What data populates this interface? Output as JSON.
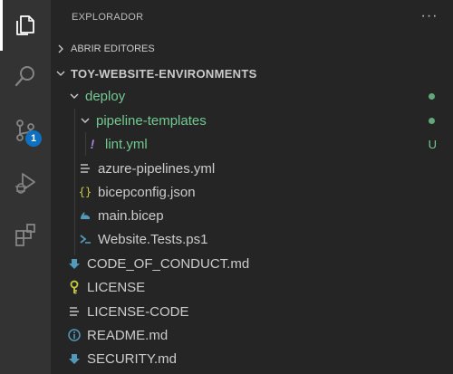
{
  "activity_bar": {
    "items": [
      {
        "name": "explorer-icon",
        "active": true
      },
      {
        "name": "search-icon",
        "active": false
      },
      {
        "name": "source-control-icon",
        "active": false,
        "badge": "1"
      },
      {
        "name": "run-debug-icon",
        "active": false
      },
      {
        "name": "extensions-icon",
        "active": false
      }
    ],
    "badge_color": "#0e70c0"
  },
  "sidebar": {
    "title": "EXPLORADOR",
    "more_label": "···",
    "open_editors_label": "ABRIR EDITORES",
    "workspace_label": "TOY-WEBSITE-ENVIRONMENTS",
    "tree": [
      {
        "label": "deploy",
        "type": "folder",
        "color": "#73c991",
        "decoration": "dot"
      },
      {
        "label": "pipeline-templates",
        "type": "folder",
        "color": "#73c991",
        "decoration": "dot"
      },
      {
        "label": "lint.yml",
        "type": "file",
        "icon": "exclamation-icon",
        "color": "#73c991",
        "decoration": "U"
      },
      {
        "label": "azure-pipelines.yml",
        "type": "file",
        "icon": "lines-icon"
      },
      {
        "label": "bicepconfig.json",
        "type": "file",
        "icon": "braces-icon"
      },
      {
        "label": "main.bicep",
        "type": "file",
        "icon": "bicep-icon"
      },
      {
        "label": "Website.Tests.ps1",
        "type": "file",
        "icon": "powershell-icon"
      },
      {
        "label": "CODE_OF_CONDUCT.md",
        "type": "file",
        "icon": "markdown-down-icon"
      },
      {
        "label": "LICENSE",
        "type": "file",
        "icon": "license-key-icon"
      },
      {
        "label": "LICENSE-CODE",
        "type": "file",
        "icon": "lines-icon"
      },
      {
        "label": "README.md",
        "type": "file",
        "icon": "info-icon"
      },
      {
        "label": "SECURITY.md",
        "type": "file",
        "icon": "markdown-down-icon"
      }
    ]
  },
  "colors": {
    "activity_bg": "#333333",
    "sidebar_bg": "#252526",
    "untracked_green": "#73c991",
    "text": "#cccccc"
  }
}
